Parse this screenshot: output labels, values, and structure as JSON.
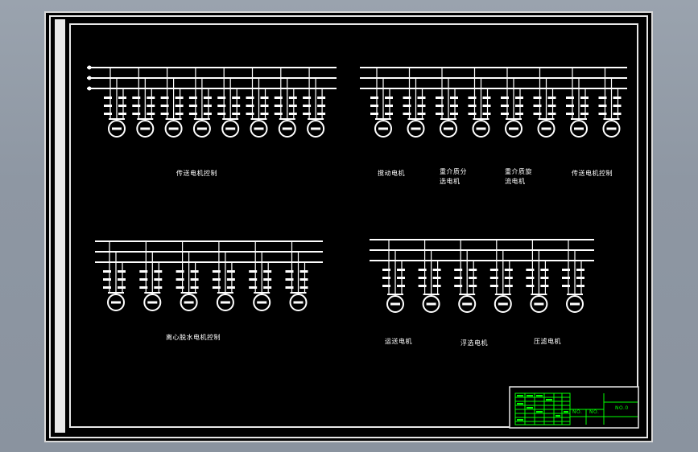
{
  "diagram": {
    "groups": [
      {
        "id": "group-a",
        "motors": 8,
        "captions": [
          "传送电机控制"
        ]
      },
      {
        "id": "group-b",
        "motors": 8,
        "captions": [
          "搅动电机",
          "重介质分\n选电机",
          "重介质旋\n流电机",
          "传送电机控制"
        ]
      },
      {
        "id": "group-c",
        "motors": 6,
        "captions": [
          "离心脱水电机控制"
        ]
      },
      {
        "id": "group-d",
        "motors": 6,
        "captions": [
          "运送电机",
          "浮选电机",
          "压滤电机"
        ]
      }
    ]
  },
  "title_block": {
    "cell_a": "NO.",
    "cell_b": "NO.",
    "cell_right": "NO.0"
  },
  "colors": {
    "drawing_line": "#ffffff",
    "title_block": "#00ff00",
    "paper": "#000000",
    "background": "#8e97a3"
  }
}
